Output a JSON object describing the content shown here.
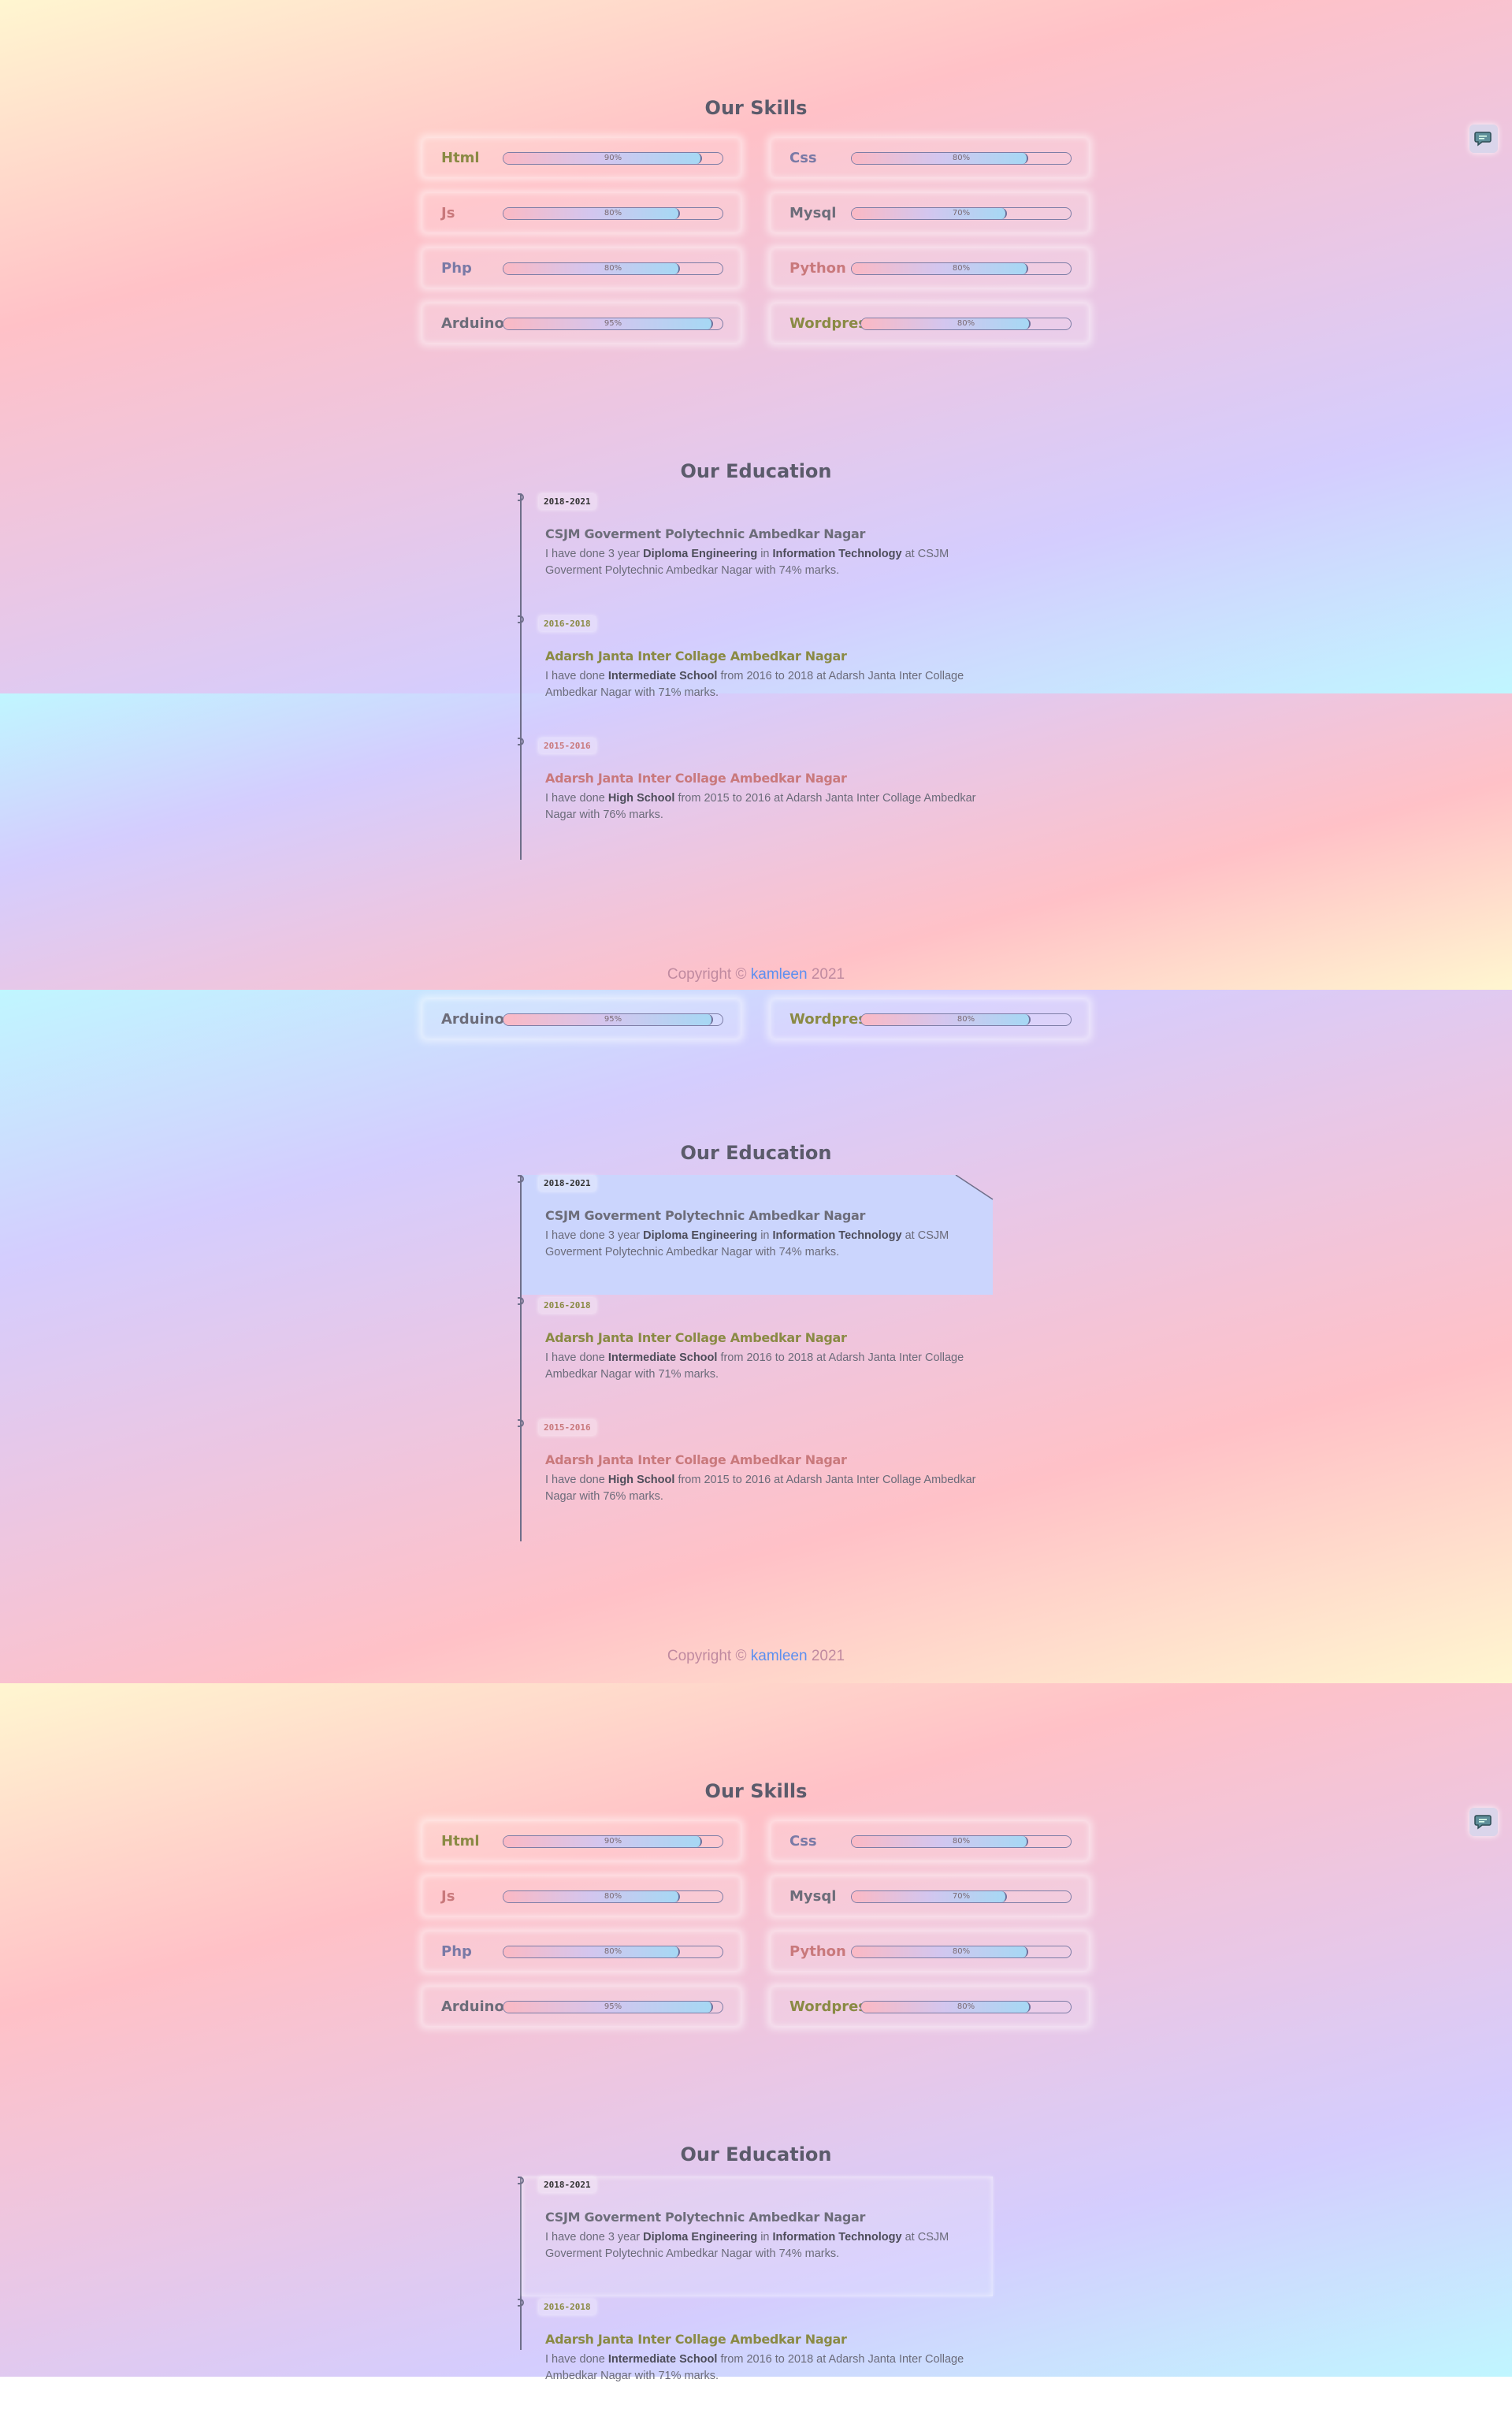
{
  "skills": {
    "title": "Our Skills",
    "items": [
      {
        "name": "Html",
        "percent": 90,
        "label": "90%",
        "color": "#8a8a44"
      },
      {
        "name": "Css",
        "percent": 80,
        "label": "80%",
        "color": "#7a7aa6"
      },
      {
        "name": "Js",
        "percent": 80,
        "label": "80%",
        "color": "#c9797c"
      },
      {
        "name": "Mysql",
        "percent": 70,
        "label": "70%",
        "color": "#6d6d7a"
      },
      {
        "name": "Php",
        "percent": 80,
        "label": "80%",
        "color": "#7a7aa6"
      },
      {
        "name": "Python",
        "percent": 80,
        "label": "80%",
        "color": "#c9797c"
      },
      {
        "name": "Arduino",
        "percent": 95,
        "label": "95%",
        "color": "#6d6d7a"
      },
      {
        "name": "Wordpress",
        "percent": 80,
        "label": "80%",
        "color": "#8a8a44"
      }
    ]
  },
  "education": {
    "title": "Our Education",
    "items": [
      {
        "date": "2018-2021",
        "title": "CSJM Goverment Polytechnic Ambedkar Nagar",
        "color": "#6d6d7a",
        "desc_pre": "I have done 3 year ",
        "desc_b1": "Diploma Engineering",
        "desc_mid": " in ",
        "desc_b2": "Information Technology",
        "desc_post": " at CSJM Goverment Polytechnic Ambedkar Nagar with 74% marks."
      },
      {
        "date": "2016-2018",
        "title": "Adarsh Janta Inter Collage Ambedkar Nagar",
        "color": "#8a8a44",
        "desc_pre": "I have done ",
        "desc_b1": "Intermediate School",
        "desc_mid": "",
        "desc_b2": "",
        "desc_post": " from 2016 to 2018 at Adarsh Janta Inter Collage Ambedkar Nagar with 71% marks."
      },
      {
        "date": "2015-2016",
        "title": "Adarsh Janta Inter Collage Ambedkar Nagar",
        "color": "#c9797c",
        "desc_pre": "I have done ",
        "desc_b1": "High School",
        "desc_mid": "",
        "desc_b2": "",
        "desc_post": " from 2015 to 2016 at Adarsh Janta Inter Collage Ambedkar Nagar with 76% marks."
      }
    ]
  },
  "footer": {
    "prefix": "Copyright © ",
    "brand": "kamleen",
    "suffix": " 2021"
  },
  "chat_button": {
    "icon": "chat-icon"
  }
}
